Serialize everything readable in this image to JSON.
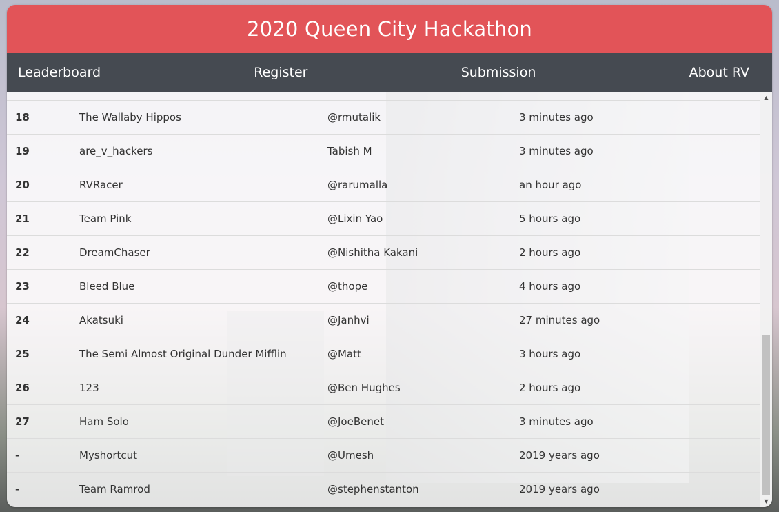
{
  "header": {
    "title": "2020 Queen City Hackathon"
  },
  "nav": {
    "items": [
      {
        "label": "Leaderboard"
      },
      {
        "label": "Register"
      },
      {
        "label": "Submission"
      },
      {
        "label": "About RV"
      }
    ]
  },
  "leaderboard": {
    "rows": [
      {
        "rank": "18",
        "team": "The Wallaby Hippos",
        "user": "@rmutalik",
        "time": "3 minutes ago"
      },
      {
        "rank": "19",
        "team": "are_v_hackers",
        "user": "Tabish M",
        "time": "3 minutes ago"
      },
      {
        "rank": "20",
        "team": "RVRacer",
        "user": "@rarumalla",
        "time": "an hour ago"
      },
      {
        "rank": "21",
        "team": "Team Pink",
        "user": "@Lixin Yao",
        "time": "5 hours ago"
      },
      {
        "rank": "22",
        "team": "DreamChaser",
        "user": "@Nishitha Kakani",
        "time": "2 hours ago"
      },
      {
        "rank": "23",
        "team": "Bleed Blue",
        "user": "@thope",
        "time": "4 hours ago"
      },
      {
        "rank": "24",
        "team": "Akatsuki",
        "user": "@Janhvi",
        "time": "27 minutes ago"
      },
      {
        "rank": "25",
        "team": "The Semi Almost Original Dunder Mifflin",
        "user": "@Matt",
        "time": "3 hours ago"
      },
      {
        "rank": "26",
        "team": "123",
        "user": "@Ben Hughes",
        "time": "2 hours ago"
      },
      {
        "rank": "27",
        "team": "Ham Solo",
        "user": "@JoeBenet",
        "time": "3 minutes ago"
      },
      {
        "rank": "-",
        "team": "Myshortcut",
        "user": "@Umesh",
        "time": "2019 years ago"
      },
      {
        "rank": "-",
        "team": "Team Ramrod",
        "user": "@stephenstanton",
        "time": "2019 years ago"
      }
    ]
  },
  "colors": {
    "title_bar": "#e25458",
    "nav_bar": "#454a51"
  }
}
